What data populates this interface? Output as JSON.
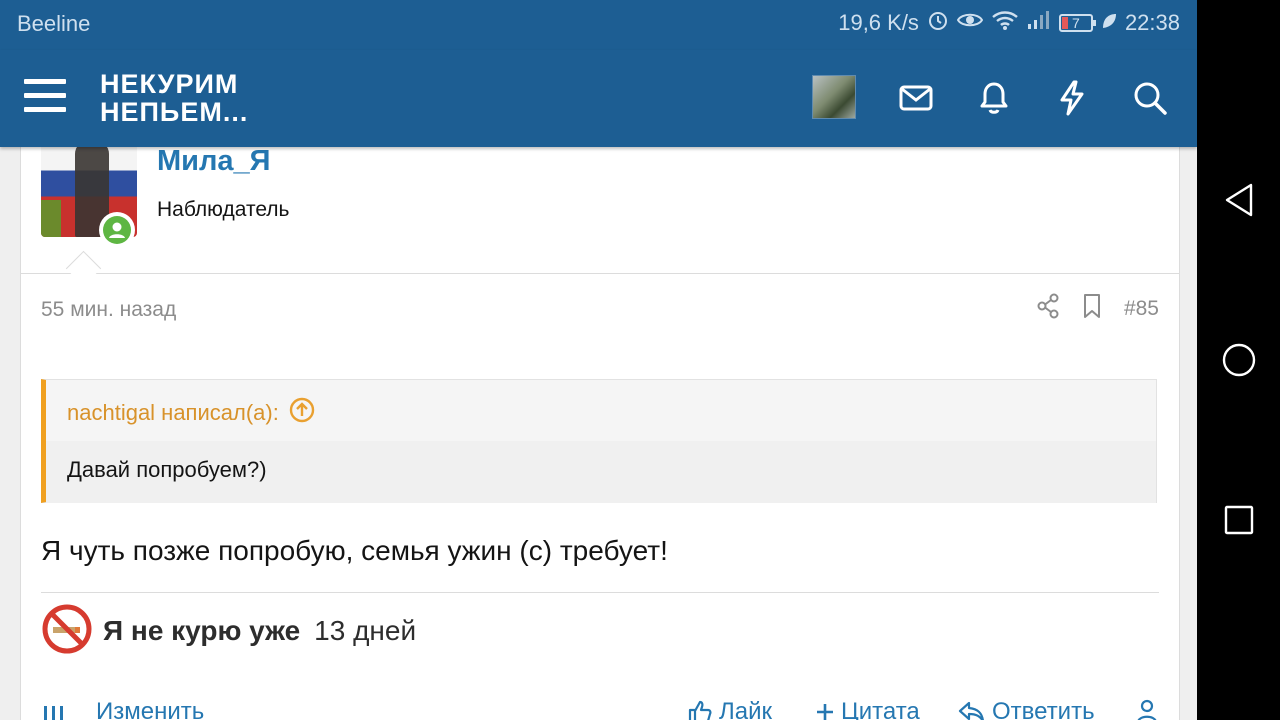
{
  "status_bar": {
    "carrier": "Beeline",
    "speed": "19,6 K/s",
    "battery": "7",
    "time": "22:38"
  },
  "header": {
    "logo_line1": "НЕКУРИМ",
    "logo_line2": "НЕПЬЕМ...",
    "icons": [
      "menu-icon",
      "avatar",
      "mail-icon",
      "bell-icon",
      "lightning-icon",
      "search-icon"
    ]
  },
  "post": {
    "username": "Мила_Я",
    "user_title": "Наблюдатель",
    "time_ago": "55 мин. назад",
    "post_number": "#85",
    "quote": {
      "author": "nachtigal написал(а):",
      "text": "Давай попробуем?)"
    },
    "text": "Я чуть позже попробую, семья ужин (с) требует!",
    "signature": {
      "label": "Я не курю уже",
      "count": "13 дней"
    },
    "actions": {
      "edit": "Изменить",
      "like": "Лайк",
      "quote": "Цитата",
      "reply": "Ответить"
    }
  },
  "colors": {
    "header_bg": "#1d5e93",
    "link": "#2577b1",
    "quote_accent": "#f0a020",
    "online": "#5eb643"
  }
}
